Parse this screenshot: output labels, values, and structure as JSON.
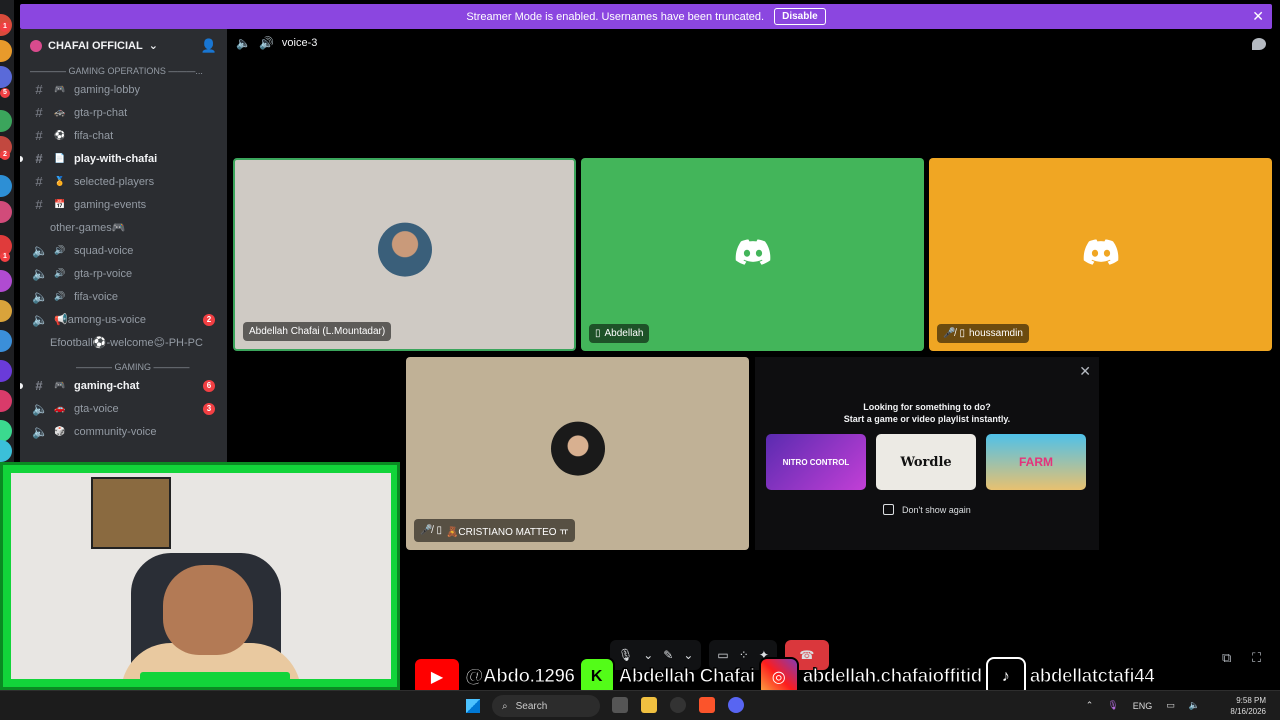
{
  "banner": {
    "text": "Streamer Mode is enabled. Usernames have been truncated.",
    "button": "Disable"
  },
  "server": {
    "name": "CHAFAI OFFICIAL"
  },
  "categories": {
    "gaming_operations": "———— GAMING OPERATIONS ———...",
    "gaming": "———— GAMING ————"
  },
  "channels": [
    {
      "name": "gaming-lobby",
      "emoji": "🎮"
    },
    {
      "name": "gta-rp-chat",
      "emoji": "🚓"
    },
    {
      "name": "fifa-chat",
      "emoji": "⚽"
    },
    {
      "name": "play-with-chafai",
      "emoji": "📄"
    },
    {
      "name": "selected-players",
      "emoji": "🏅"
    },
    {
      "name": "gaming-events",
      "emoji": "📅"
    },
    {
      "name": "other-games🎮"
    },
    {
      "name": "squad-voice",
      "emoji": "🔊"
    },
    {
      "name": "gta-rp-voice",
      "emoji": "🔊"
    },
    {
      "name": "fifa-voice",
      "emoji": "🔊"
    },
    {
      "name": "📢among-us-voice",
      "badge": "2"
    },
    {
      "name": "Efootball⚽-welcome😊-PH-PC"
    },
    {
      "name": "gaming-chat",
      "emoji": "🎮",
      "badge": "6"
    },
    {
      "name": "gta-voice",
      "emoji": "🚗",
      "badge": "3"
    },
    {
      "name": "community-voice",
      "emoji": "🎲"
    }
  ],
  "voice": {
    "channel": "voice-3"
  },
  "participants": [
    {
      "name": "Abdellah Chafai (L.Mountadar)"
    },
    {
      "name": "Abdellah"
    },
    {
      "name": "houssamdin"
    },
    {
      "name": "🧸CRISTIANO MATTEO ㅠ"
    }
  ],
  "activity": {
    "title_line1": "Looking for something to do?",
    "title_line2": "Start a game or video playlist instantly.",
    "cards": [
      "NITRO CONTROL",
      "Wordle",
      "FARM"
    ],
    "dont_show": "Don't show again"
  },
  "social": {
    "youtube": "@Abdo.1296",
    "kick": "Abdellah Chafai",
    "instagram": "abdellah.chafaioffitid",
    "tiktok": "abdellatctafi44"
  },
  "taskbar": {
    "search": "Search",
    "lang": "ENG",
    "time": "9:58 PM",
    "date": "8/16/2026"
  },
  "colors": {
    "banner": "#8b46e0",
    "tile_green": "#43b55a",
    "tile_orange": "#f0a623",
    "sidebar": "#2b2d31"
  }
}
